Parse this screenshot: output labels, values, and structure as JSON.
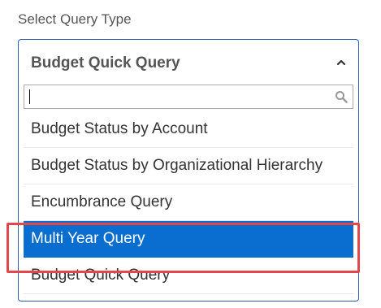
{
  "field": {
    "label": "Select Query Type",
    "selected_value": "Budget Quick Query"
  },
  "search": {
    "value": "",
    "placeholder": ""
  },
  "options": [
    {
      "label": "Budget Status by Account",
      "highlighted": false
    },
    {
      "label": "Budget Status by Organizational Hierarchy",
      "highlighted": false
    },
    {
      "label": "Encumbrance Query",
      "highlighted": false
    },
    {
      "label": "Multi Year Query",
      "highlighted": true
    },
    {
      "label": "Budget Quick Query",
      "highlighted": false
    }
  ],
  "icons": {
    "caret": "chevron-up-icon",
    "search": "search-icon"
  },
  "colors": {
    "accent": "#0a6ed1",
    "border": "#2a5db0",
    "annotation": "#e5464a"
  }
}
